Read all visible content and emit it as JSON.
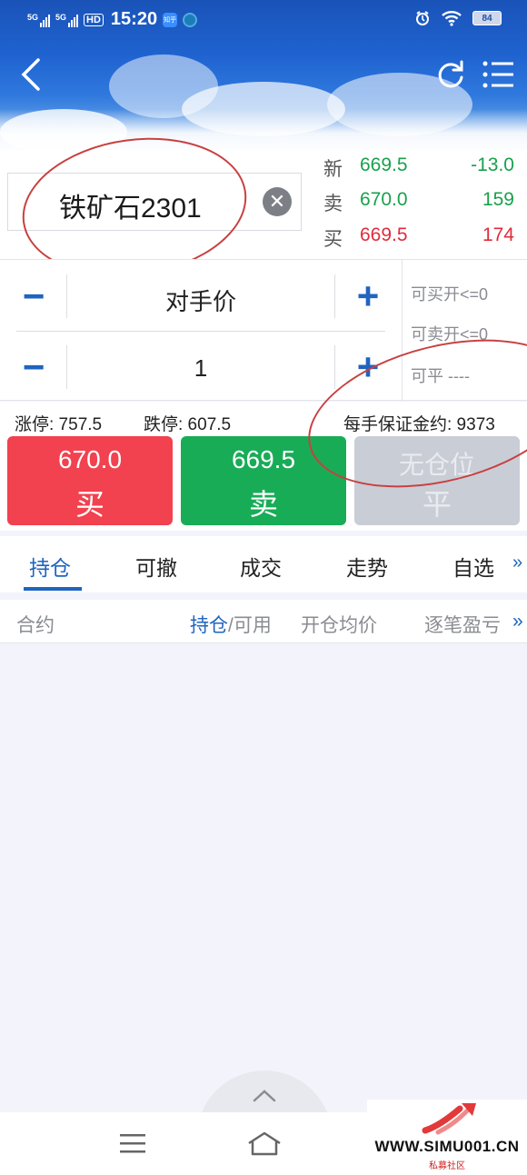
{
  "status_bar": {
    "time": "15:20",
    "network1": "5G",
    "network2": "5G",
    "hd_label": "HD",
    "app_badge": "知乎",
    "battery": "84"
  },
  "quote": {
    "symbol": "铁矿石2301",
    "rows": [
      {
        "label": "新",
        "price": "669.5",
        "right": "-13.0"
      },
      {
        "label": "卖",
        "price": "670.0",
        "right": "159"
      },
      {
        "label": "买",
        "price": "669.5",
        "right": "174"
      }
    ]
  },
  "order": {
    "price_type": "对手价",
    "quantity": "1",
    "can_buy_open": "可买开<=0",
    "can_sell_open": "可卖开<=0",
    "can_close": "可平 ----"
  },
  "limits": {
    "limit_up": "涨停: 757.5",
    "limit_down": "跌停: 607.5",
    "margin": "每手保证金约: 9373"
  },
  "buttons": {
    "buy_price": "670.0",
    "buy_label": "买",
    "sell_price": "669.5",
    "sell_label": "卖",
    "close_top": "无仓位",
    "close_label": "平"
  },
  "tabs": [
    "持仓",
    "可撤",
    "成交",
    "走势",
    "自选"
  ],
  "table_header": {
    "contract": "合约",
    "position_highlight": "持仓",
    "position_rest": "/可用",
    "avg_open": "开仓均价",
    "pnl": "逐笔盈亏"
  },
  "more_symbol": "»",
  "watermark": {
    "site": "WWW.SIMU001.CN",
    "sub": "私募社区"
  },
  "colors": {
    "accent": "#1f64bf",
    "buy": "#f2424f",
    "sell": "#19ac57",
    "disabled": "#c9cdd6"
  }
}
